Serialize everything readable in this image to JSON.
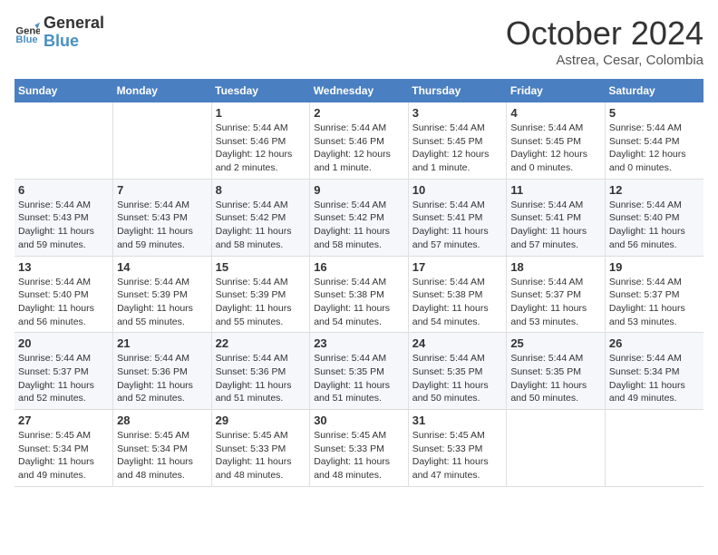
{
  "logo": {
    "line1": "General",
    "line2": "Blue"
  },
  "title": "October 2024",
  "subtitle": "Astrea, Cesar, Colombia",
  "days_of_week": [
    "Sunday",
    "Monday",
    "Tuesday",
    "Wednesday",
    "Thursday",
    "Friday",
    "Saturday"
  ],
  "weeks": [
    [
      {
        "day": "",
        "content": ""
      },
      {
        "day": "",
        "content": ""
      },
      {
        "day": "1",
        "content": "Sunrise: 5:44 AM\nSunset: 5:46 PM\nDaylight: 12 hours and 2 minutes."
      },
      {
        "day": "2",
        "content": "Sunrise: 5:44 AM\nSunset: 5:46 PM\nDaylight: 12 hours and 1 minute."
      },
      {
        "day": "3",
        "content": "Sunrise: 5:44 AM\nSunset: 5:45 PM\nDaylight: 12 hours and 1 minute."
      },
      {
        "day": "4",
        "content": "Sunrise: 5:44 AM\nSunset: 5:45 PM\nDaylight: 12 hours and 0 minutes."
      },
      {
        "day": "5",
        "content": "Sunrise: 5:44 AM\nSunset: 5:44 PM\nDaylight: 12 hours and 0 minutes."
      }
    ],
    [
      {
        "day": "6",
        "content": "Sunrise: 5:44 AM\nSunset: 5:43 PM\nDaylight: 11 hours and 59 minutes."
      },
      {
        "day": "7",
        "content": "Sunrise: 5:44 AM\nSunset: 5:43 PM\nDaylight: 11 hours and 59 minutes."
      },
      {
        "day": "8",
        "content": "Sunrise: 5:44 AM\nSunset: 5:42 PM\nDaylight: 11 hours and 58 minutes."
      },
      {
        "day": "9",
        "content": "Sunrise: 5:44 AM\nSunset: 5:42 PM\nDaylight: 11 hours and 58 minutes."
      },
      {
        "day": "10",
        "content": "Sunrise: 5:44 AM\nSunset: 5:41 PM\nDaylight: 11 hours and 57 minutes."
      },
      {
        "day": "11",
        "content": "Sunrise: 5:44 AM\nSunset: 5:41 PM\nDaylight: 11 hours and 57 minutes."
      },
      {
        "day": "12",
        "content": "Sunrise: 5:44 AM\nSunset: 5:40 PM\nDaylight: 11 hours and 56 minutes."
      }
    ],
    [
      {
        "day": "13",
        "content": "Sunrise: 5:44 AM\nSunset: 5:40 PM\nDaylight: 11 hours and 56 minutes."
      },
      {
        "day": "14",
        "content": "Sunrise: 5:44 AM\nSunset: 5:39 PM\nDaylight: 11 hours and 55 minutes."
      },
      {
        "day": "15",
        "content": "Sunrise: 5:44 AM\nSunset: 5:39 PM\nDaylight: 11 hours and 55 minutes."
      },
      {
        "day": "16",
        "content": "Sunrise: 5:44 AM\nSunset: 5:38 PM\nDaylight: 11 hours and 54 minutes."
      },
      {
        "day": "17",
        "content": "Sunrise: 5:44 AM\nSunset: 5:38 PM\nDaylight: 11 hours and 54 minutes."
      },
      {
        "day": "18",
        "content": "Sunrise: 5:44 AM\nSunset: 5:37 PM\nDaylight: 11 hours and 53 minutes."
      },
      {
        "day": "19",
        "content": "Sunrise: 5:44 AM\nSunset: 5:37 PM\nDaylight: 11 hours and 53 minutes."
      }
    ],
    [
      {
        "day": "20",
        "content": "Sunrise: 5:44 AM\nSunset: 5:37 PM\nDaylight: 11 hours and 52 minutes."
      },
      {
        "day": "21",
        "content": "Sunrise: 5:44 AM\nSunset: 5:36 PM\nDaylight: 11 hours and 52 minutes."
      },
      {
        "day": "22",
        "content": "Sunrise: 5:44 AM\nSunset: 5:36 PM\nDaylight: 11 hours and 51 minutes."
      },
      {
        "day": "23",
        "content": "Sunrise: 5:44 AM\nSunset: 5:35 PM\nDaylight: 11 hours and 51 minutes."
      },
      {
        "day": "24",
        "content": "Sunrise: 5:44 AM\nSunset: 5:35 PM\nDaylight: 11 hours and 50 minutes."
      },
      {
        "day": "25",
        "content": "Sunrise: 5:44 AM\nSunset: 5:35 PM\nDaylight: 11 hours and 50 minutes."
      },
      {
        "day": "26",
        "content": "Sunrise: 5:44 AM\nSunset: 5:34 PM\nDaylight: 11 hours and 49 minutes."
      }
    ],
    [
      {
        "day": "27",
        "content": "Sunrise: 5:45 AM\nSunset: 5:34 PM\nDaylight: 11 hours and 49 minutes."
      },
      {
        "day": "28",
        "content": "Sunrise: 5:45 AM\nSunset: 5:34 PM\nDaylight: 11 hours and 48 minutes."
      },
      {
        "day": "29",
        "content": "Sunrise: 5:45 AM\nSunset: 5:33 PM\nDaylight: 11 hours and 48 minutes."
      },
      {
        "day": "30",
        "content": "Sunrise: 5:45 AM\nSunset: 5:33 PM\nDaylight: 11 hours and 48 minutes."
      },
      {
        "day": "31",
        "content": "Sunrise: 5:45 AM\nSunset: 5:33 PM\nDaylight: 11 hours and 47 minutes."
      },
      {
        "day": "",
        "content": ""
      },
      {
        "day": "",
        "content": ""
      }
    ]
  ]
}
